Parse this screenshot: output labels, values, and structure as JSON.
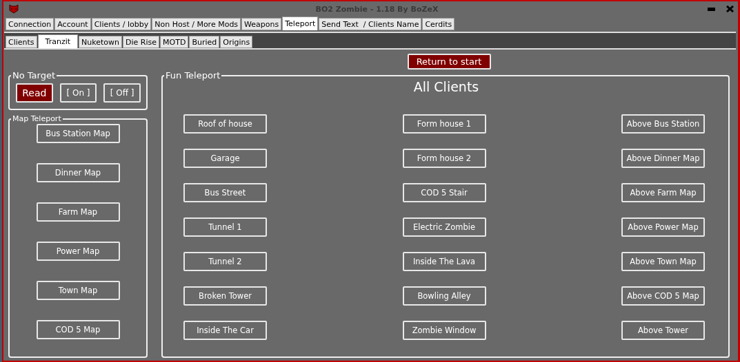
{
  "window": {
    "title": "BO2 Zombie - 1.18 By BoZeX"
  },
  "tabs": [
    {
      "label": "Connection",
      "selected": false
    },
    {
      "label": "Account",
      "selected": false
    },
    {
      "label": "Clients / lobby",
      "selected": false
    },
    {
      "label": "Non Host / More Mods",
      "selected": false
    },
    {
      "label": "Weapons",
      "selected": false
    },
    {
      "label": "Teleport",
      "selected": true
    },
    {
      "label": "Send Text  / Clients Name",
      "selected": false
    },
    {
      "label": "Cerdits",
      "selected": false
    }
  ],
  "subtabs": [
    {
      "label": "Clients",
      "selected": false
    },
    {
      "label": "Tranzit",
      "selected": true
    },
    {
      "label": "Nuketown",
      "selected": false
    },
    {
      "label": "Die Rise",
      "selected": false
    },
    {
      "label": "MOTD",
      "selected": false
    },
    {
      "label": "Buried",
      "selected": false
    },
    {
      "label": "Origins",
      "selected": false
    }
  ],
  "return_button": {
    "label": "Return to start"
  },
  "no_target": {
    "title": "No Target",
    "buttons": [
      {
        "label": "Read",
        "kind": "filled"
      },
      {
        "label": "[ On ]",
        "kind": "outline"
      },
      {
        "label": "[ Off ]",
        "kind": "outline"
      }
    ]
  },
  "map_teleport": {
    "title": "Map Teleport",
    "buttons": [
      "Bus Station Map",
      "Dinner Map",
      "Farm Map",
      "Power Map",
      "Town Map",
      "COD 5 Map"
    ]
  },
  "fun_teleport": {
    "title": "Fun Teleport",
    "heading": "All Clients",
    "buttons": [
      "Roof of house",
      "Form house 1",
      "Above Bus Station",
      "Garage",
      "Form house 2",
      "Above Dinner Map",
      "Bus Street",
      "COD 5 Stair",
      "Above Farm Map",
      "Tunnel 1",
      "Electric Zombie",
      "Above Power Map",
      "Tunnel 2",
      "Inside The Lava",
      "Above Town Map",
      "Broken Tower",
      "Bowling Alley",
      "Above COD 5 Map",
      "Inside The Car",
      "Zombie Window",
      "Above Tower"
    ]
  }
}
